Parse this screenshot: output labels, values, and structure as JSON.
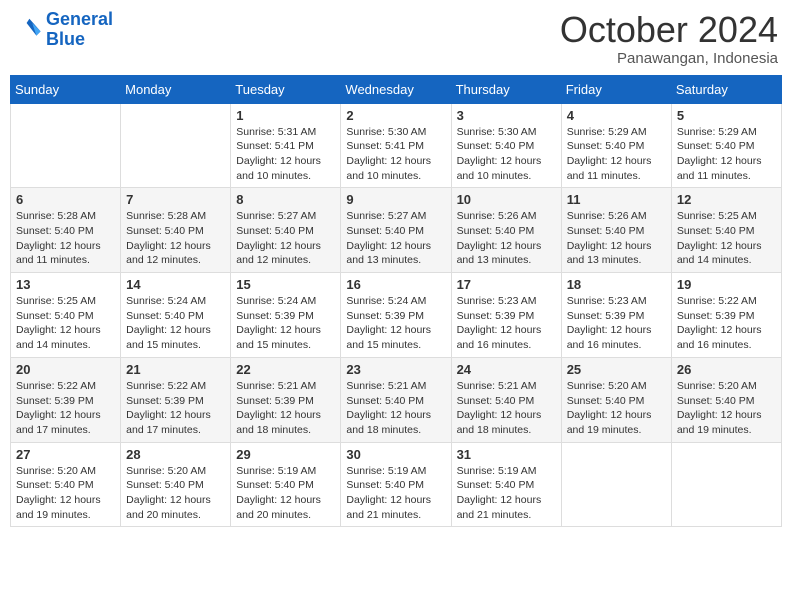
{
  "header": {
    "logo_line1": "General",
    "logo_line2": "Blue",
    "month": "October 2024",
    "location": "Panawangan, Indonesia"
  },
  "weekdays": [
    "Sunday",
    "Monday",
    "Tuesday",
    "Wednesday",
    "Thursday",
    "Friday",
    "Saturday"
  ],
  "weeks": [
    [
      {
        "day": "",
        "info": ""
      },
      {
        "day": "",
        "info": ""
      },
      {
        "day": "1",
        "info": "Sunrise: 5:31 AM\nSunset: 5:41 PM\nDaylight: 12 hours and 10 minutes."
      },
      {
        "day": "2",
        "info": "Sunrise: 5:30 AM\nSunset: 5:41 PM\nDaylight: 12 hours and 10 minutes."
      },
      {
        "day": "3",
        "info": "Sunrise: 5:30 AM\nSunset: 5:40 PM\nDaylight: 12 hours and 10 minutes."
      },
      {
        "day": "4",
        "info": "Sunrise: 5:29 AM\nSunset: 5:40 PM\nDaylight: 12 hours and 11 minutes."
      },
      {
        "day": "5",
        "info": "Sunrise: 5:29 AM\nSunset: 5:40 PM\nDaylight: 12 hours and 11 minutes."
      }
    ],
    [
      {
        "day": "6",
        "info": "Sunrise: 5:28 AM\nSunset: 5:40 PM\nDaylight: 12 hours and 11 minutes."
      },
      {
        "day": "7",
        "info": "Sunrise: 5:28 AM\nSunset: 5:40 PM\nDaylight: 12 hours and 12 minutes."
      },
      {
        "day": "8",
        "info": "Sunrise: 5:27 AM\nSunset: 5:40 PM\nDaylight: 12 hours and 12 minutes."
      },
      {
        "day": "9",
        "info": "Sunrise: 5:27 AM\nSunset: 5:40 PM\nDaylight: 12 hours and 13 minutes."
      },
      {
        "day": "10",
        "info": "Sunrise: 5:26 AM\nSunset: 5:40 PM\nDaylight: 12 hours and 13 minutes."
      },
      {
        "day": "11",
        "info": "Sunrise: 5:26 AM\nSunset: 5:40 PM\nDaylight: 12 hours and 13 minutes."
      },
      {
        "day": "12",
        "info": "Sunrise: 5:25 AM\nSunset: 5:40 PM\nDaylight: 12 hours and 14 minutes."
      }
    ],
    [
      {
        "day": "13",
        "info": "Sunrise: 5:25 AM\nSunset: 5:40 PM\nDaylight: 12 hours and 14 minutes."
      },
      {
        "day": "14",
        "info": "Sunrise: 5:24 AM\nSunset: 5:40 PM\nDaylight: 12 hours and 15 minutes."
      },
      {
        "day": "15",
        "info": "Sunrise: 5:24 AM\nSunset: 5:39 PM\nDaylight: 12 hours and 15 minutes."
      },
      {
        "day": "16",
        "info": "Sunrise: 5:24 AM\nSunset: 5:39 PM\nDaylight: 12 hours and 15 minutes."
      },
      {
        "day": "17",
        "info": "Sunrise: 5:23 AM\nSunset: 5:39 PM\nDaylight: 12 hours and 16 minutes."
      },
      {
        "day": "18",
        "info": "Sunrise: 5:23 AM\nSunset: 5:39 PM\nDaylight: 12 hours and 16 minutes."
      },
      {
        "day": "19",
        "info": "Sunrise: 5:22 AM\nSunset: 5:39 PM\nDaylight: 12 hours and 16 minutes."
      }
    ],
    [
      {
        "day": "20",
        "info": "Sunrise: 5:22 AM\nSunset: 5:39 PM\nDaylight: 12 hours and 17 minutes."
      },
      {
        "day": "21",
        "info": "Sunrise: 5:22 AM\nSunset: 5:39 PM\nDaylight: 12 hours and 17 minutes."
      },
      {
        "day": "22",
        "info": "Sunrise: 5:21 AM\nSunset: 5:39 PM\nDaylight: 12 hours and 18 minutes."
      },
      {
        "day": "23",
        "info": "Sunrise: 5:21 AM\nSunset: 5:40 PM\nDaylight: 12 hours and 18 minutes."
      },
      {
        "day": "24",
        "info": "Sunrise: 5:21 AM\nSunset: 5:40 PM\nDaylight: 12 hours and 18 minutes."
      },
      {
        "day": "25",
        "info": "Sunrise: 5:20 AM\nSunset: 5:40 PM\nDaylight: 12 hours and 19 minutes."
      },
      {
        "day": "26",
        "info": "Sunrise: 5:20 AM\nSunset: 5:40 PM\nDaylight: 12 hours and 19 minutes."
      }
    ],
    [
      {
        "day": "27",
        "info": "Sunrise: 5:20 AM\nSunset: 5:40 PM\nDaylight: 12 hours and 19 minutes."
      },
      {
        "day": "28",
        "info": "Sunrise: 5:20 AM\nSunset: 5:40 PM\nDaylight: 12 hours and 20 minutes."
      },
      {
        "day": "29",
        "info": "Sunrise: 5:19 AM\nSunset: 5:40 PM\nDaylight: 12 hours and 20 minutes."
      },
      {
        "day": "30",
        "info": "Sunrise: 5:19 AM\nSunset: 5:40 PM\nDaylight: 12 hours and 21 minutes."
      },
      {
        "day": "31",
        "info": "Sunrise: 5:19 AM\nSunset: 5:40 PM\nDaylight: 12 hours and 21 minutes."
      },
      {
        "day": "",
        "info": ""
      },
      {
        "day": "",
        "info": ""
      }
    ]
  ]
}
